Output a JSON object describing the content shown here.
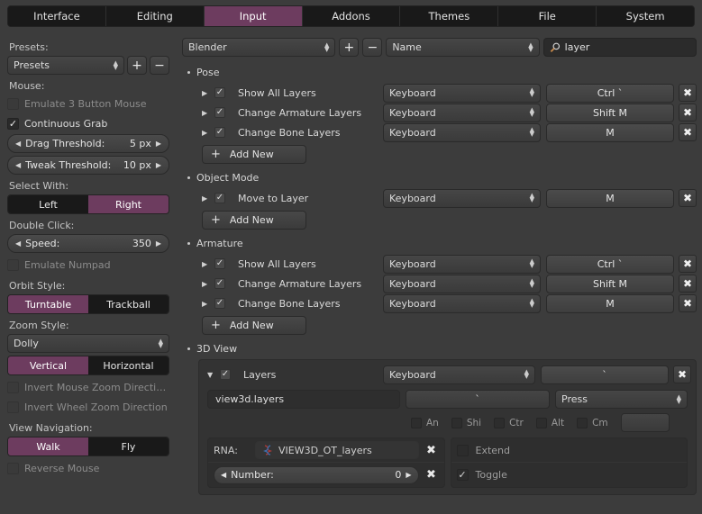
{
  "tabs": [
    {
      "label": "Interface",
      "active": false
    },
    {
      "label": "Editing",
      "active": false
    },
    {
      "label": "Input",
      "active": true
    },
    {
      "label": "Addons",
      "active": false
    },
    {
      "label": "Themes",
      "active": false
    },
    {
      "label": "File",
      "active": false
    },
    {
      "label": "System",
      "active": false
    }
  ],
  "accent_color": "#6d3c5f",
  "sidebar": {
    "presets_label": "Presets:",
    "presets_value": "Presets",
    "add_icon": "plus-icon",
    "remove_icon": "minus-icon",
    "mouse_label": "Mouse:",
    "emulate3_label": "Emulate 3 Button Mouse",
    "emulate3_checked": false,
    "continuous_grab_label": "Continuous Grab",
    "continuous_grab_checked": true,
    "drag_threshold_label": "Drag Threshold:",
    "drag_threshold_value": "5 px",
    "tweak_threshold_label": "Tweak Threshold:",
    "tweak_threshold_value": "10 px",
    "select_with_label": "Select With:",
    "select_left": "Left",
    "select_right": "Right",
    "select_active": "Right",
    "double_click_label": "Double Click:",
    "speed_label": "Speed:",
    "speed_value": "350",
    "emulate_numpad_label": "Emulate Numpad",
    "emulate_numpad_checked": false,
    "orbit_style_label": "Orbit Style:",
    "orbit_turntable": "Turntable",
    "orbit_trackball": "Trackball",
    "orbit_active": "Turntable",
    "zoom_style_label": "Zoom Style:",
    "zoom_style_value": "Dolly",
    "zoom_vertical": "Vertical",
    "zoom_horizontal": "Horizontal",
    "zoom_axis_active": "Vertical",
    "invert_mouse_zoom_label": "Invert Mouse Zoom Directi…",
    "invert_mouse_zoom_checked": false,
    "invert_wheel_zoom_label": "Invert Wheel Zoom Direction",
    "invert_wheel_zoom_checked": false,
    "view_navigation_label": "View Navigation:",
    "nav_walk": "Walk",
    "nav_fly": "Fly",
    "nav_active": "Walk",
    "reverse_mouse_label": "Reverse Mouse",
    "reverse_mouse_checked": false
  },
  "header": {
    "keyconfig_value": "Blender",
    "add_icon": "plus-icon",
    "remove_icon": "minus-icon",
    "filter_type_value": "Name",
    "search_icon": "magnifier-icon",
    "search_value": "layer"
  },
  "groups": [
    {
      "name": "Pose",
      "add_new_label": "Add New",
      "items": [
        {
          "name": "Show All Layers",
          "enabled": true,
          "device": "Keyboard",
          "key": "Ctrl `"
        },
        {
          "name": "Change Armature Layers",
          "enabled": true,
          "device": "Keyboard",
          "key": "Shift M"
        },
        {
          "name": "Change Bone Layers",
          "enabled": true,
          "device": "Keyboard",
          "key": "M"
        }
      ]
    },
    {
      "name": "Object Mode",
      "add_new_label": "Add New",
      "items": [
        {
          "name": "Move to Layer",
          "enabled": true,
          "device": "Keyboard",
          "key": "M"
        }
      ]
    },
    {
      "name": "Armature",
      "add_new_label": "Add New",
      "items": [
        {
          "name": "Show All Layers",
          "enabled": true,
          "device": "Keyboard",
          "key": "Ctrl `"
        },
        {
          "name": "Change Armature Layers",
          "enabled": true,
          "device": "Keyboard",
          "key": "Shift M"
        },
        {
          "name": "Change Bone Layers",
          "enabled": true,
          "device": "Keyboard",
          "key": "M"
        }
      ]
    }
  ],
  "view3d_group": {
    "name": "3D View",
    "expanded_item": {
      "name": "Layers",
      "enabled": true,
      "device": "Keyboard",
      "key": "`",
      "operator": "view3d.layers",
      "key_field": "`",
      "event_value": "Press",
      "modifiers": [
        {
          "label": "An",
          "checked": false
        },
        {
          "label": "Shi",
          "checked": false
        },
        {
          "label": "Ctr",
          "checked": false
        },
        {
          "label": "Alt",
          "checked": false
        },
        {
          "label": "Cm",
          "checked": false
        }
      ],
      "keymod_value": "",
      "rna_label": "RNA:",
      "rna_icon": "script-icon",
      "rna_value": "VIEW3D_OT_layers",
      "number_label": "Number:",
      "number_value": "0",
      "extend_label": "Extend",
      "extend_checked": false,
      "toggle_label": "Toggle",
      "toggle_checked": true,
      "clear_icon": "x-icon"
    }
  }
}
